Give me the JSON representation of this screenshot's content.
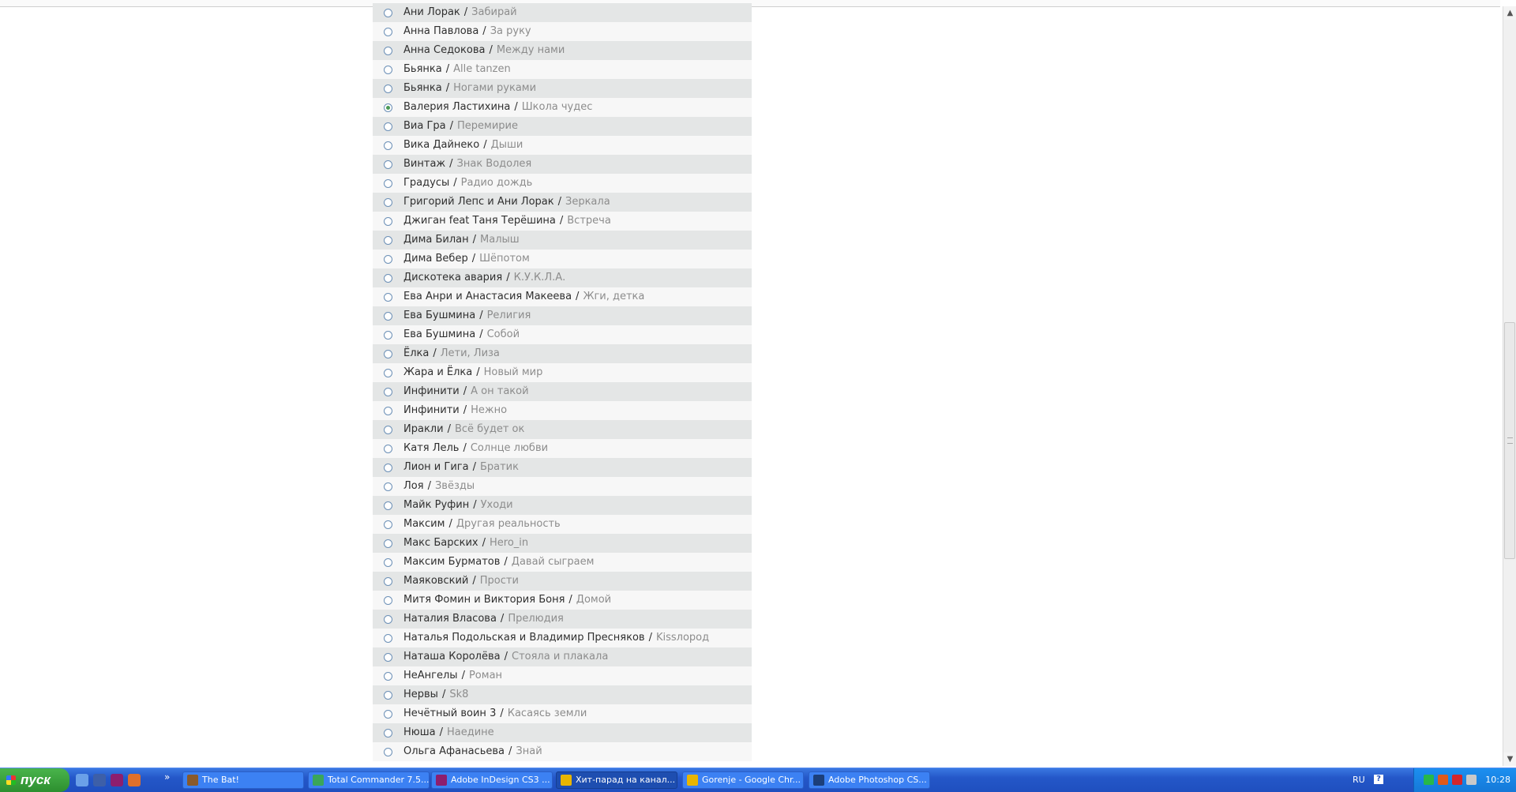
{
  "list": {
    "items": [
      {
        "artist": "Ани Лорак",
        "sep": "/",
        "song": "Забирай",
        "checked": false
      },
      {
        "artist": "Анна Павлова",
        "sep": "/",
        "song": "За руку",
        "checked": false
      },
      {
        "artist": "Анна Седокова",
        "sep": "/",
        "song": "Между нами",
        "checked": false
      },
      {
        "artist": "Бьянка",
        "sep": "/",
        "song": "Alle tanzen",
        "checked": false
      },
      {
        "artist": "Бьянка",
        "sep": "/",
        "song": "Ногами руками",
        "checked": false
      },
      {
        "artist": "Валерия Ластихина",
        "sep": "/",
        "song": "Школа чудес",
        "checked": true
      },
      {
        "artist": "Виа Гра",
        "sep": "/",
        "song": "Перемирие",
        "checked": false
      },
      {
        "artist": "Вика Дайнеко",
        "sep": "/",
        "song": "Дыши",
        "checked": false
      },
      {
        "artist": "Винтаж",
        "sep": "/",
        "song": "Знак Водолея",
        "checked": false
      },
      {
        "artist": "Градусы",
        "sep": "/",
        "song": "Радио дождь",
        "checked": false
      },
      {
        "artist": "Григорий Лепс и Ани Лорак",
        "sep": "/",
        "song": "Зеркала",
        "checked": false
      },
      {
        "artist": "Джиган feat Таня Терёшина",
        "sep": "/",
        "song": "Встреча",
        "checked": false
      },
      {
        "artist": "Дима Билан",
        "sep": "/",
        "song": "Малыш",
        "checked": false
      },
      {
        "artist": "Дима Вебер",
        "sep": "/",
        "song": "Шёпотом",
        "checked": false
      },
      {
        "artist": "Дискотека авария",
        "sep": "/",
        "song": "К.У.К.Л.А.",
        "checked": false
      },
      {
        "artist": "Ева Анри и Анастасия Макеева",
        "sep": "/",
        "song": "Жги, детка",
        "checked": false
      },
      {
        "artist": "Ева Бушмина",
        "sep": "/",
        "song": "Религия",
        "checked": false
      },
      {
        "artist": "Ева Бушмина",
        "sep": "/",
        "song": "Собой",
        "checked": false
      },
      {
        "artist": "Ёлка",
        "sep": "/",
        "song": "Лети, Лиза",
        "checked": false
      },
      {
        "artist": "Жара и Ёлка",
        "sep": "/",
        "song": "Новый мир",
        "checked": false
      },
      {
        "artist": "Инфинити",
        "sep": "/",
        "song": "А он такой",
        "checked": false
      },
      {
        "artist": "Инфинити",
        "sep": "/",
        "song": "Нежно",
        "checked": false
      },
      {
        "artist": "Иракли",
        "sep": "/",
        "song": "Всё будет ок",
        "checked": false
      },
      {
        "artist": "Катя Лель",
        "sep": "/",
        "song": "Солнце любви",
        "checked": false
      },
      {
        "artist": "Лион и Гига",
        "sep": "/",
        "song": "Братик",
        "checked": false
      },
      {
        "artist": "Лоя",
        "sep": "/",
        "song": "Звёзды",
        "checked": false
      },
      {
        "artist": "Майк Руфин",
        "sep": "/",
        "song": "Уходи",
        "checked": false
      },
      {
        "artist": "Максим",
        "sep": "/",
        "song": "Другая реальность",
        "checked": false
      },
      {
        "artist": "Макс Барских",
        "sep": "/",
        "song": "Hero_in",
        "checked": false
      },
      {
        "artist": "Максим Бурматов",
        "sep": "/",
        "song": "Давай сыграем",
        "checked": false
      },
      {
        "artist": "Маяковский",
        "sep": "/",
        "song": "Прости",
        "checked": false
      },
      {
        "artist": "Митя Фомин и Виктория Боня",
        "sep": "/",
        "song": "Домой",
        "checked": false
      },
      {
        "artist": "Наталия Власова",
        "sep": "/",
        "song": "Прелюдия",
        "checked": false
      },
      {
        "artist": "Наталья Подольская и Владимир Пресняков",
        "sep": "/",
        "song": "Kissлород",
        "checked": false
      },
      {
        "artist": "Наташа Королёва",
        "sep": "/",
        "song": "Стояла и плакала",
        "checked": false
      },
      {
        "artist": "НеАнгелы",
        "sep": "/",
        "song": "Роман",
        "checked": false
      },
      {
        "artist": "Нервы",
        "sep": "/",
        "song": "Sk8",
        "checked": false
      },
      {
        "artist": "Нечётный воин 3",
        "sep": "/",
        "song": "Касаясь земли",
        "checked": false
      },
      {
        "artist": "Нюша",
        "sep": "/",
        "song": "Наедине",
        "checked": false
      },
      {
        "artist": "Ольга Афанасьева",
        "sep": "/",
        "song": "Знай",
        "checked": false
      }
    ]
  },
  "taskbar": {
    "start_label": "пуск",
    "tasks": [
      {
        "label": "The Bat!",
        "icon": "bat-icon",
        "color": "#8a5a2b"
      },
      {
        "label": "Total Commander 7.5...",
        "icon": "total-commander-icon",
        "color": "#3aa65a"
      },
      {
        "label": "Adobe InDesign CS3 ...",
        "icon": "indesign-icon",
        "color": "#8d1e6e"
      },
      {
        "label": "Хит-парад на канал...",
        "icon": "chrome-icon",
        "color": "#e8b500",
        "active": true
      },
      {
        "label": "Gorenje - Google Chr...",
        "icon": "chrome-icon",
        "color": "#e8b500"
      },
      {
        "label": "Adobe Photoshop CS...",
        "icon": "photoshop-icon",
        "color": "#1c3f7a"
      }
    ],
    "language": "RU",
    "help_label": "?",
    "clock": "10:28"
  },
  "colors": {
    "row_odd": "#e4e6e6",
    "row_even": "#f7f7f7",
    "artist": "#2f2f2f",
    "song": "#8c8c8c",
    "radio_checked": "#4a9a56",
    "taskbar_blue": "#2457c8",
    "start_green": "#2d8f2f"
  }
}
